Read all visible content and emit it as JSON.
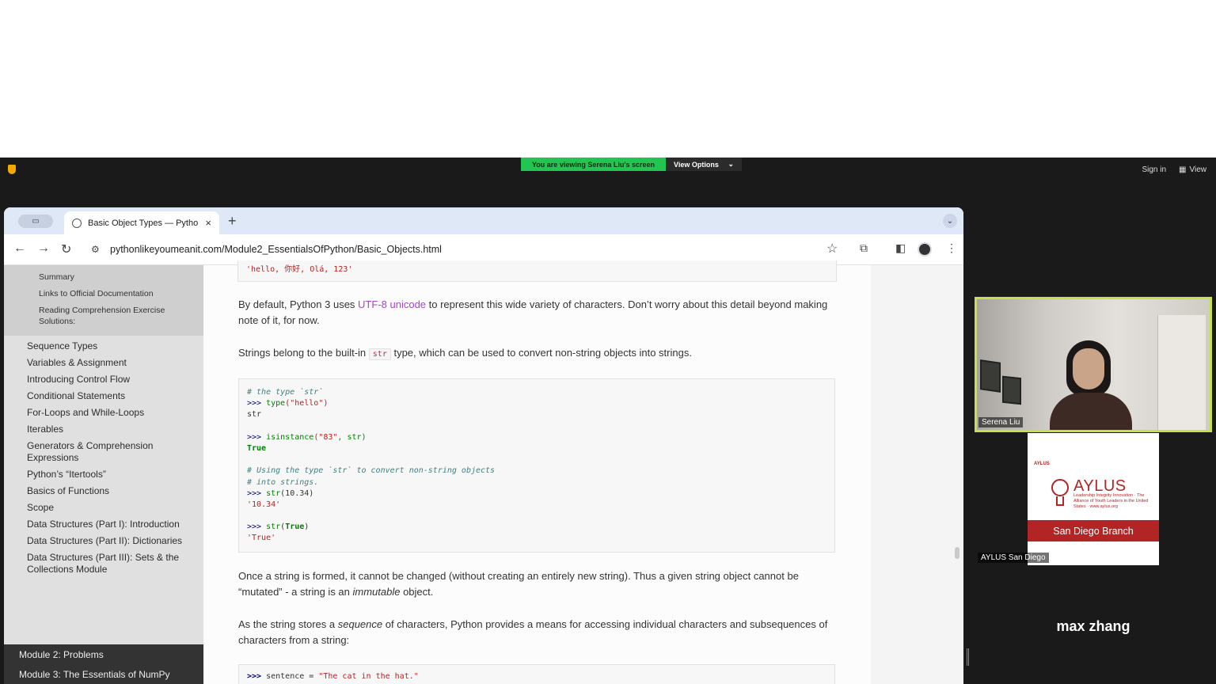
{
  "zoom": {
    "banner": "You are viewing Serena Liu's screen",
    "view_options": "View Options",
    "view_options_chevron": "⌄",
    "sign_in": "Sign in",
    "view": "View"
  },
  "browser": {
    "tab_title": "Basic Object Types — Python",
    "tab_close": "×",
    "new_tab": "+",
    "url": "pythonlikeyoumeanit.com/Module2_EssentialsOfPython/Basic_Objects.html"
  },
  "sidebar": {
    "sub_items": [
      "Summary",
      "Links to Official Documentation",
      "Reading Comprehension Exercise Solutions:"
    ],
    "items": [
      "Sequence Types",
      "Variables & Assignment",
      "Introducing Control Flow",
      "Conditional Statements",
      "For-Loops and While-Loops",
      "Iterables",
      "Generators & Comprehension Expressions",
      "Python’s “Itertools”",
      "Basics of Functions",
      "Scope",
      "Data Structures (Part I): Introduction",
      "Data Structures (Part II): Dictionaries",
      "Data Structures (Part III): Sets & the Collections Module"
    ],
    "modules": [
      "Module 2: Problems",
      "Module 3: The Essentials of NumPy"
    ]
  },
  "article": {
    "prev_code": "'hello, 你好, Olá, 123'",
    "p1_before": "By default, Python 3 uses ",
    "p1_link": "UTF-8 unicode",
    "p1_after": " to represent this wide variety of characters. Don’t worry about this detail beyond making note of it, for now.",
    "p2_before": "Strings belong to the built-in ",
    "p2_code": "str",
    "p2_after": " type, which can be used to convert non-string objects into strings.",
    "code": {
      "c1": "# the type `str`",
      "l1_prompt": ">>> ",
      "l1_fn": "type",
      "l1_args": "(\"hello\")",
      "out1": "str",
      "l2_prompt": ">>> ",
      "l2_fn": "isinstance",
      "l2_args_a": "(\"83\"",
      "l2_args_b": ", str)",
      "out2": "True",
      "c2": "# Using the type `str` to convert non-string objects",
      "c3": "# into strings.",
      "l3_prompt": ">>> ",
      "l3_fn": "str",
      "l3_args": "(10.34)",
      "out3": "'10.34'",
      "l4_prompt": ">>> ",
      "l4_fn": "str",
      "l4_args_open": "(",
      "l4_true": "True",
      "l4_args_close": ")",
      "out4": "'True'"
    },
    "p3_a": "Once a string is formed, it cannot be changed (without creating an entirely new string). Thus a given string object cannot be “mutated” - a string is an ",
    "p3_em": "immutable",
    "p3_b": " object.",
    "p4_a": "As the string stores a ",
    "p4_em": "sequence",
    "p4_b": " of characters, Python provides a means for accessing individual characters and subsequences of characters from a string:",
    "code2_prompt": ">>> ",
    "code2_var": "sentence = ",
    "code2_str": "\"The cat in the hat.\""
  },
  "participants": [
    {
      "name": "Serena Liu"
    },
    {
      "name": "AYLUS San Diego",
      "logo_text": "AYLUS",
      "logo_small": "AYLUS",
      "tagline": "Leadership Integrity Innovation · The Alliance of Youth Leaders in the United States · www.aylus.org",
      "branch": "San Diego Branch"
    },
    {
      "name": "max zhang"
    }
  ],
  "colors": {
    "banner_green": "#23c552",
    "active_speaker_border": "#c8e04a",
    "aylus_red": "#b32525",
    "link_purple": "#a347c7"
  }
}
